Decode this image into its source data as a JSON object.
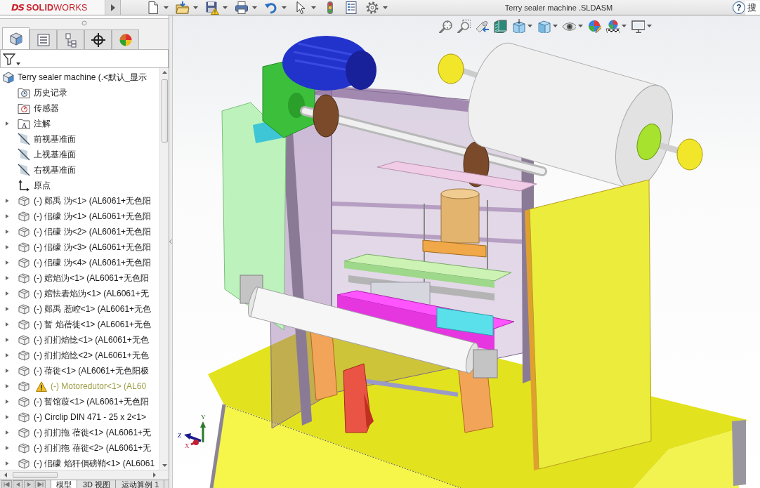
{
  "toolbar": {
    "logo": {
      "mark": "DS",
      "name": "**SOLID**WORKS"
    },
    "items": [
      {
        "kind": "new",
        "dropdown": true
      },
      {
        "kind": "open",
        "dropdown": true
      },
      {
        "kind": "save",
        "dropdown": true
      },
      {
        "kind": "print",
        "dropdown": true
      },
      {
        "kind": "undo",
        "dropdown": true
      },
      {
        "kind": "select",
        "dropdown": true
      },
      {
        "kind": "rebuild",
        "dropdown": false
      },
      {
        "kind": "file-properties",
        "dropdown": false
      },
      {
        "kind": "options",
        "dropdown": true
      }
    ]
  },
  "window": {
    "title": "Terry sealer machine .SLDASM"
  },
  "help": {
    "label": "?"
  },
  "search": {
    "placeholder": "搜"
  },
  "panel_tabs": [
    {
      "kind": "feature-manager",
      "selected": true
    },
    {
      "kind": "property-manager",
      "selected": false
    },
    {
      "kind": "configuration-manager",
      "selected": false
    },
    {
      "kind": "dimxpert-manager",
      "selected": false
    },
    {
      "kind": "display-manager",
      "selected": false
    }
  ],
  "tree": {
    "root": {
      "kind": "assembly",
      "label": "Terry sealer machine (.<默认_显示",
      "children": [
        {
          "kind": "folder-history",
          "label": "历史记录",
          "expandable": false,
          "warning": false
        },
        {
          "kind": "folder-sensors",
          "label": "传感器",
          "expandable": false,
          "warning": false
        },
        {
          "kind": "folder-annotations",
          "label": "注解",
          "icon_letter": "A",
          "expandable": true,
          "warning": false
        },
        {
          "kind": "plane",
          "label": "前视基准面",
          "expandable": false,
          "warning": false
        },
        {
          "kind": "plane",
          "label": "上视基准面",
          "expandable": false,
          "warning": false
        },
        {
          "kind": "plane",
          "label": "右视基准面",
          "expandable": false,
          "warning": false
        },
        {
          "kind": "origin",
          "label": "原点",
          "expandable": false,
          "warning": false
        },
        {
          "kind": "part",
          "label": "(-) 郧禹 沩<1> (AL6061+无色阳",
          "expandable": true,
          "warning": false
        },
        {
          "kind": "part",
          "label": "(-) 佀礞 沩<1> (AL6061+无色阳",
          "expandable": true,
          "warning": false
        },
        {
          "kind": "part",
          "label": "(-) 佀礞 沩<2> (AL6061+无色阳",
          "expandable": true,
          "warning": false
        },
        {
          "kind": "part",
          "label": "(-) 佀礞 沩<3> (AL6061+无色阳",
          "expandable": true,
          "warning": false
        },
        {
          "kind": "part",
          "label": "(-) 佀礞 沩<4> (AL6061+无色阳",
          "expandable": true,
          "warning": false
        },
        {
          "kind": "part",
          "label": "(-) 婠焰沩<1> (AL6061+无色阳",
          "expandable": true,
          "warning": false
        },
        {
          "kind": "part",
          "label": "(-) 婠怯砉焰沩<1> (AL6061+无",
          "expandable": true,
          "warning": false
        },
        {
          "kind": "part",
          "label": "(-) 郧禹 惹崆<1> (AL6061+无色",
          "expandable": true,
          "warning": false
        },
        {
          "kind": "part",
          "label": "(-) 暂 焰蓓徙<1> (AL6061+无色",
          "expandable": true,
          "warning": false
        },
        {
          "kind": "part",
          "label": "(-) 扪扪焰惗<1> (AL6061+无色",
          "expandable": true,
          "warning": false
        },
        {
          "kind": "part",
          "label": "(-) 扪扪焰惗<2> (AL6061+无色",
          "expandable": true,
          "warning": false
        },
        {
          "kind": "part",
          "label": "(-) 蓓徙<1> (AL6061+无色阳极",
          "expandable": true,
          "warning": false
        },
        {
          "kind": "part",
          "label": "(-) Motoredutor<1> (AL60",
          "expandable": true,
          "warning": true
        },
        {
          "kind": "part",
          "label": "(-) 暂馆葭<1> (AL6061+无色阳",
          "expandable": true,
          "warning": false
        },
        {
          "kind": "part",
          "label": "(-) Circlip DIN 471 - 25 x 2<1>",
          "expandable": true,
          "warning": false
        },
        {
          "kind": "part",
          "label": "(-) 扪扪拖 蓓徙<1> (AL6061+无",
          "expandable": true,
          "warning": false
        },
        {
          "kind": "part",
          "label": "(-) 扪扪拖 蓓徙<2> (AL6061+无",
          "expandable": true,
          "warning": false
        },
        {
          "kind": "part",
          "label": "(-) 佀礞 焰犴傊磅鞘<1> (AL6061",
          "expandable": true,
          "warning": false
        }
      ]
    }
  },
  "bottom_tabs": [
    {
      "label": "模型",
      "selected": true
    },
    {
      "label": "3D 视图",
      "selected": false
    },
    {
      "label": "运动算例 1",
      "selected": false
    }
  ],
  "view_toolbar": [
    {
      "kind": "zoom-to-fit",
      "dropdown": false
    },
    {
      "kind": "zoom-area",
      "dropdown": false
    },
    {
      "kind": "previous-view",
      "dropdown": false
    },
    {
      "kind": "section-view",
      "dropdown": false
    },
    {
      "kind": "view-orientation",
      "dropdown": true
    },
    {
      "kind": "display-style",
      "dropdown": true
    },
    {
      "kind": "hide-show",
      "dropdown": true
    },
    {
      "kind": "edit-appearance",
      "dropdown": false
    },
    {
      "kind": "apply-scene",
      "dropdown": true
    },
    {
      "kind": "view-settings",
      "dropdown": true
    }
  ],
  "triad": [
    {
      "kind": "x",
      "label": "X"
    },
    {
      "kind": "y",
      "label": "Y"
    },
    {
      "kind": "z",
      "label": "Z"
    }
  ]
}
